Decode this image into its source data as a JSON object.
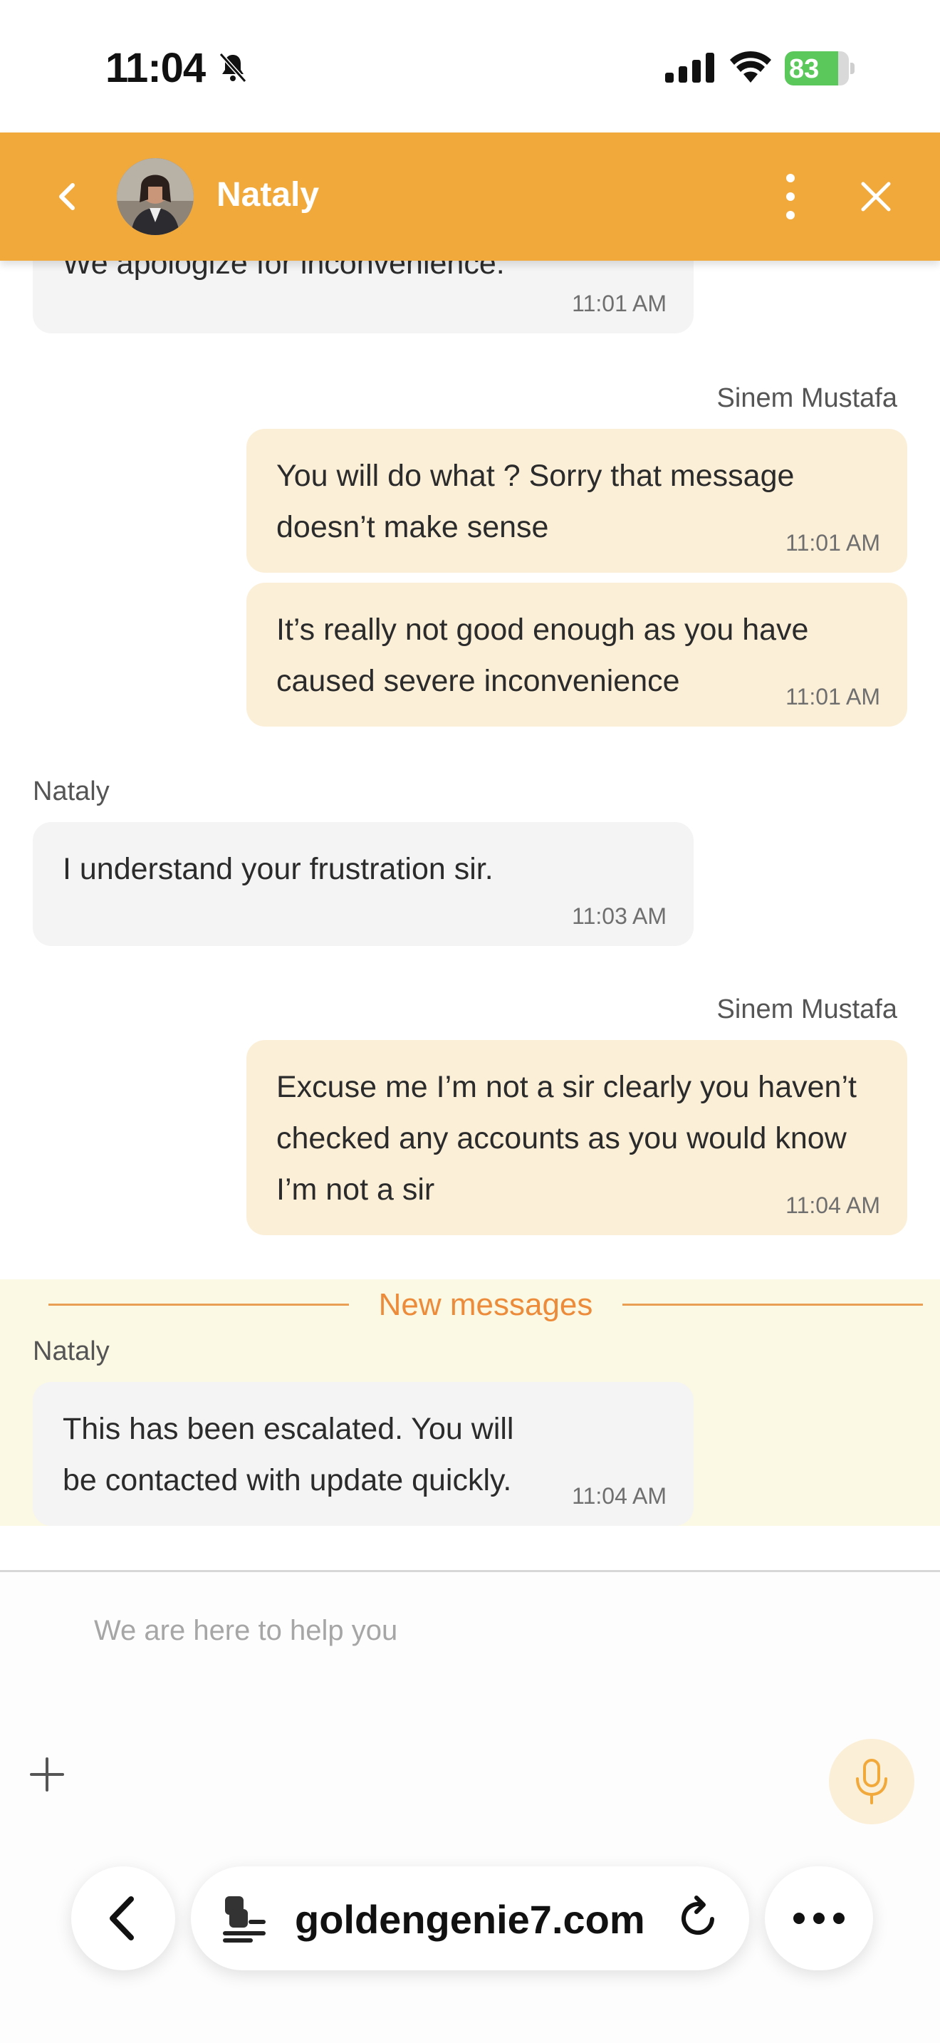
{
  "status_bar": {
    "time": "11:04",
    "battery": "83"
  },
  "header": {
    "agent_name": "Nataly"
  },
  "messages": [
    {
      "id": 0,
      "side": "agent",
      "text": "We apologize for inconvenience.",
      "time": "11:01 AM"
    },
    {
      "id": 1,
      "side": "user",
      "sender": "Sinem Mustafa",
      "text": "You will do what ? Sorry that message doesn’t make sense",
      "time": "11:01 AM"
    },
    {
      "id": 2,
      "side": "user",
      "text": "It’s really not good enough as you have caused severe inconvenience",
      "time": "11:01 AM"
    },
    {
      "id": 3,
      "side": "agent",
      "sender": "Nataly",
      "text": "I understand your frustration sir.",
      "time": "11:03 AM"
    },
    {
      "id": 4,
      "side": "user",
      "sender": "Sinem Mustafa",
      "text": "Excuse me I’m not a sir clearly you haven’t checked any accounts as you would know I’m not a sir",
      "time": "11:04 AM"
    },
    {
      "id": 5,
      "side": "agent",
      "sender": "Nataly",
      "text": "This has been escalated. You will be contacted with update quickly.",
      "time": "11:04 AM"
    }
  ],
  "new_messages_label": "New messages",
  "composer": {
    "placeholder": "We are here to help you"
  },
  "browser": {
    "url": "goldengenie7.com"
  },
  "colors": {
    "header": "#f2a93b",
    "user_bubble": "#fcefd8",
    "agent_bubble": "#f4f4f4",
    "new_messages_accent": "#ec8b3a"
  }
}
